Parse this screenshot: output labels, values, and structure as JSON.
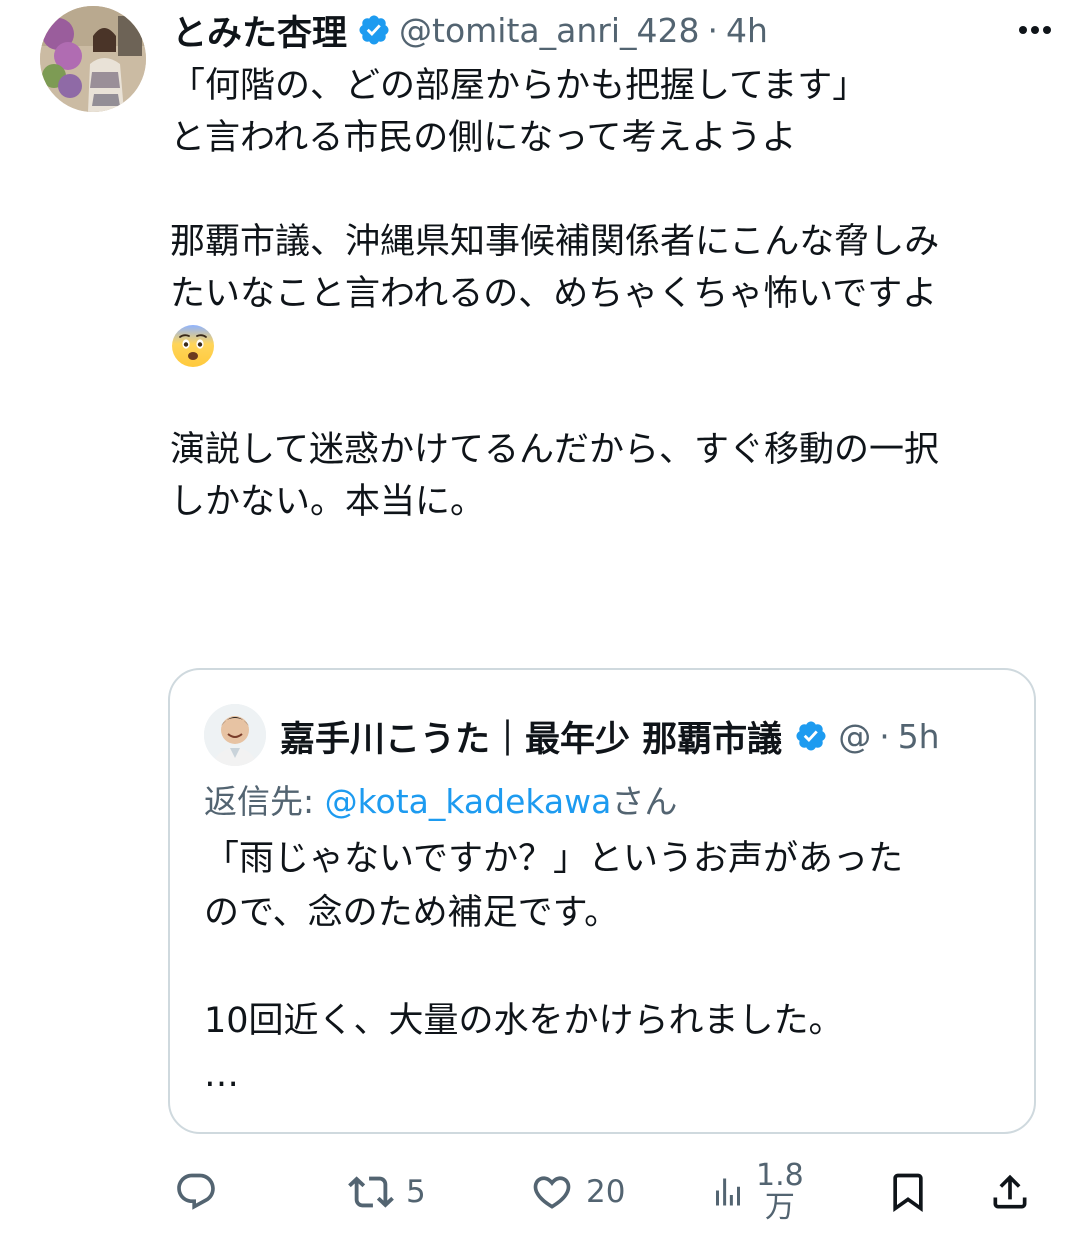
{
  "tweet": {
    "author": {
      "display_name": "とみた杏理",
      "handle": "@tomita_anri_428",
      "separator": "·",
      "time": "4h",
      "verified_icon": "verified-badge-icon",
      "avatar_icon": "avatar-photo"
    },
    "more_icon": "more-dots-icon",
    "body_lines": [
      "「何階の、どの部屋からかも把握してます」",
      "と言われる市民の側になって考えようよ",
      "",
      "那覇市議、沖縄県知事候補関係者にこんな脅しみ",
      "たいなこと言われるの、めちゃくちゃ怖いですよ",
      "😨",
      "",
      "演説して迷惑かけてるんだから、すぐ移動の一択",
      "しかない。本当に。"
    ],
    "quote": {
      "author": {
        "display_name": "嘉手川こうた｜最年少 那覇市議",
        "handle": "@",
        "separator": "·",
        "time": "5h"
      },
      "reply_prefix": "返信先: ",
      "reply_mention": "@kota_kadekawa",
      "reply_suffix": "さん",
      "body_lines": [
        "「雨じゃないですか？」というお声があった",
        "ので、念のため補足です。",
        "",
        "10回近く、大量の水をかけられました。",
        "…"
      ]
    },
    "actions": {
      "reply": {
        "icon": "reply-icon",
        "count": ""
      },
      "retweet": {
        "icon": "retweet-icon",
        "count": "5"
      },
      "like": {
        "icon": "heart-icon",
        "count": "20"
      },
      "views": {
        "icon": "views-chart-icon",
        "count_top": "1.8",
        "count_bottom": "万"
      },
      "bookmark": {
        "icon": "bookmark-icon"
      },
      "share": {
        "icon": "share-icon"
      }
    },
    "colors": {
      "text": "#0f1419",
      "secondary": "#536471",
      "accent": "#1d9bf0",
      "border": "#cfd9de"
    }
  }
}
